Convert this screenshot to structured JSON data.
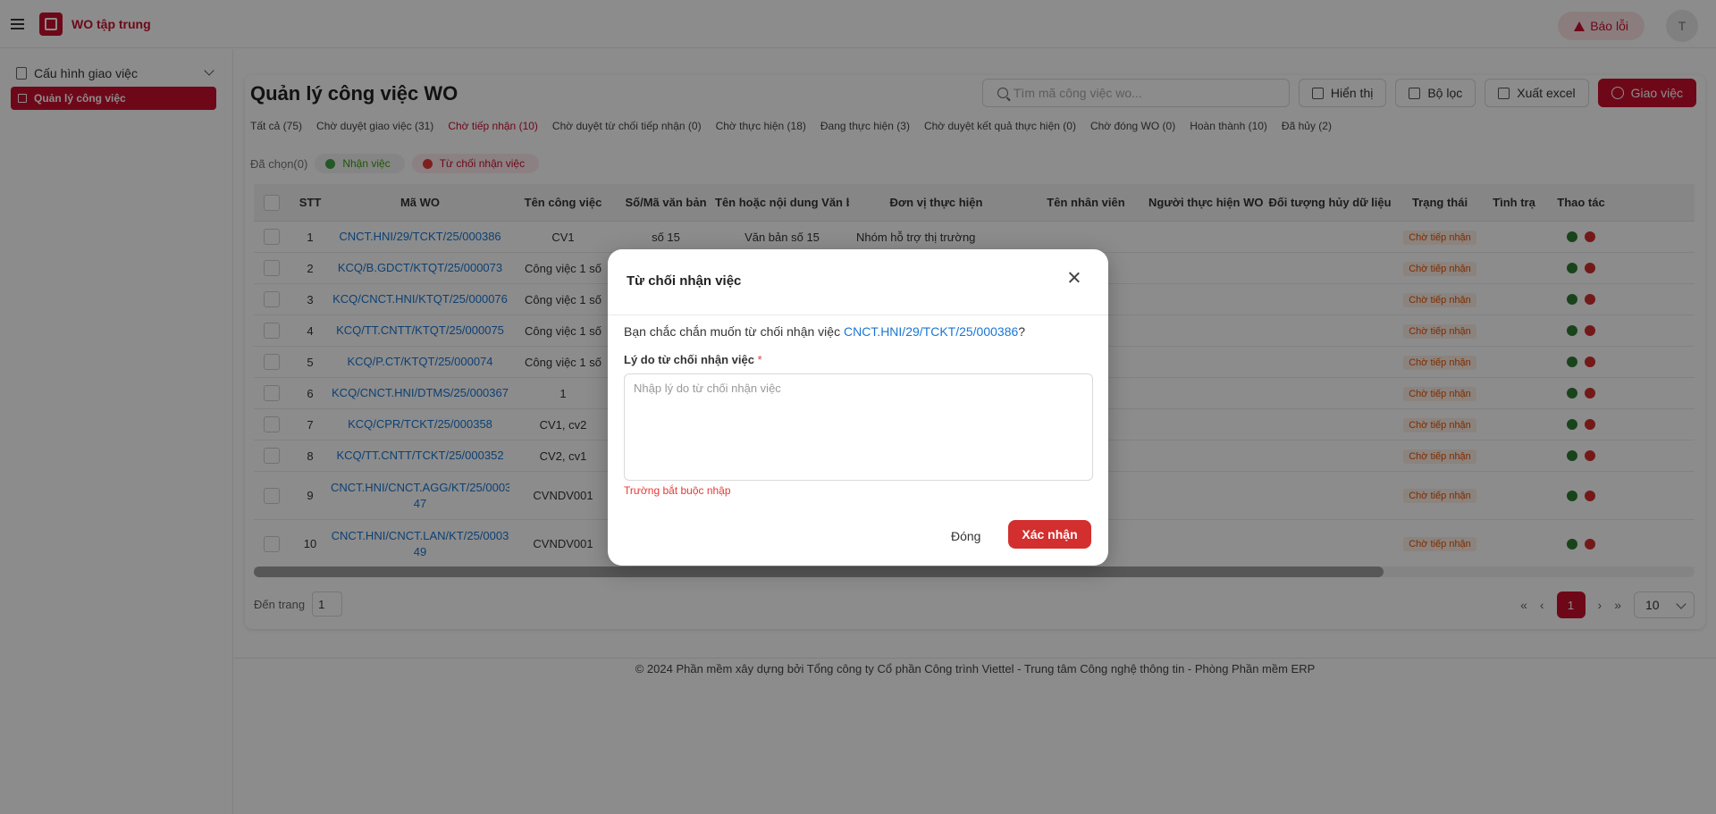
{
  "header": {
    "app_title": "WO tập trung",
    "report_label": "Báo lỗi",
    "avatar_letter": "T"
  },
  "sidebar": {
    "group_label": "Cấu hình giao việc",
    "active_item": "Quản lý công việc"
  },
  "main": {
    "page_title": "Quản lý công việc WO",
    "search_placeholder": "Tìm mã công việc wo...",
    "toolbar": {
      "display_label": "Hiển thị",
      "filter_label": "Bộ lọc",
      "export_label": "Xuất excel",
      "assign_label": "Giao việc"
    },
    "tabs": [
      "Tất cả (75)",
      "Chờ duyệt giao việc (31)",
      "Chờ tiếp nhận (10)",
      "Chờ duyệt từ chối tiếp nhận (0)",
      "Chờ thực hiện (18)",
      "Đang thực hiện (3)",
      "Chờ duyệt kết quả thực hiện (0)",
      "Chờ đóng WO (0)",
      "Hoàn thành (10)",
      "Đã hủy (2)"
    ],
    "selected_label": "Đã chọn(0)",
    "accept_label": "Nhận việc",
    "reject_label": "Từ chối nhận việc",
    "columns": [
      "STT",
      "Mã WO",
      "Tên công việc",
      "Số/Mã văn bản",
      "Tên hoặc nội dung Văn bản",
      "Đơn vị thực hiện",
      "Tên nhân viên",
      "Người thực hiện WO",
      "Đối tượng hủy dữ liệu",
      "Trạng thái",
      "Tình trạ",
      "Thao tác"
    ],
    "rows": [
      {
        "stt": "1",
        "ma": "CNCT.HNI/29/TCKT/25/000386",
        "ten": "CV1",
        "so": "số 15",
        "vb": "Văn bản số 15",
        "dv": "Nhóm hỗ trợ thị trường",
        "status": "Chờ tiếp nhận"
      },
      {
        "stt": "2",
        "ma": "KCQ/B.GDCT/KTQT/25/000073",
        "ten": "Công việc 1 số",
        "so": "",
        "vb": "",
        "dv": "",
        "status": "Chờ tiếp nhận"
      },
      {
        "stt": "3",
        "ma": "KCQ/CNCT.HNI/KTQT/25/000076",
        "ten": "Công việc 1 số",
        "so": "",
        "vb": "",
        "dv": "",
        "status": "Chờ tiếp nhận"
      },
      {
        "stt": "4",
        "ma": "KCQ/TT.CNTT/KTQT/25/000075",
        "ten": "Công việc 1 số",
        "so": "",
        "vb": "",
        "dv": "",
        "status": "Chờ tiếp nhận"
      },
      {
        "stt": "5",
        "ma": "KCQ/P.CT/KTQT/25/000074",
        "ten": "Công việc 1 số",
        "so": "",
        "vb": "",
        "dv": "",
        "status": "Chờ tiếp nhận"
      },
      {
        "stt": "6",
        "ma": "KCQ/CNCT.HNI/DTMS/25/000367",
        "ten": "1",
        "so": "",
        "vb": "",
        "dv": "",
        "status": "Chờ tiếp nhận"
      },
      {
        "stt": "7",
        "ma": "KCQ/CPR/TCKT/25/000358",
        "ten": "CV1, cv2",
        "so": "",
        "vb": "",
        "dv": "",
        "status": "Chờ tiếp nhận"
      },
      {
        "stt": "8",
        "ma": "KCQ/TT.CNTT/TCKT/25/000352",
        "ten": "CV2, cv1",
        "so": "",
        "vb": "",
        "dv": "",
        "status": "Chờ tiếp nhận"
      },
      {
        "stt": "9",
        "ma": "CNCT.HNI/CNCT.AGG/KT/25/000347",
        "ma_l1": "CNCT.HNI/CNCT.AGG/KT/25/0003",
        "ma_l2": "47",
        "ten": "CVNDV001",
        "so": "",
        "vb": "",
        "dv": "",
        "status": "Chờ tiếp nhận"
      },
      {
        "stt": "10",
        "ma": "CNCT.HNI/CNCT.LAN/KT/25/000349",
        "ma_l1": "CNCT.HNI/CNCT.LAN/KT/25/0003",
        "ma_l2": "49",
        "ten": "CVNDV001",
        "so": "",
        "vb": "",
        "dv": "",
        "status": "Chờ tiếp nhận"
      }
    ],
    "goto_label": "Đến trang",
    "goto_value": "1",
    "current_page": "1",
    "page_size": "10"
  },
  "footer": "© 2024 Phần mềm xây dựng bởi Tổng công ty Cổ phần Công trình Viettel - Trung tâm Công nghệ thông tin - Phòng Phần mềm ERP",
  "modal": {
    "title": "Từ chối nhận việc",
    "message_prefix": "Bạn chắc chắn muốn từ chối nhận việc ",
    "message_code": "CNCT.HNI/29/TCKT/25/000386",
    "message_suffix": "?",
    "reason_label": "Lý do từ chối nhận việc",
    "required_mark": "*",
    "reason_placeholder": "Nhập lý do từ chối nhận việc",
    "error_text": "Trường bắt buộc nhập",
    "close_label": "Đóng",
    "confirm_label": "Xác nhận"
  },
  "colors": {
    "brand": "#c8102e",
    "link": "#1976d2",
    "status_orange": "#e65100"
  }
}
